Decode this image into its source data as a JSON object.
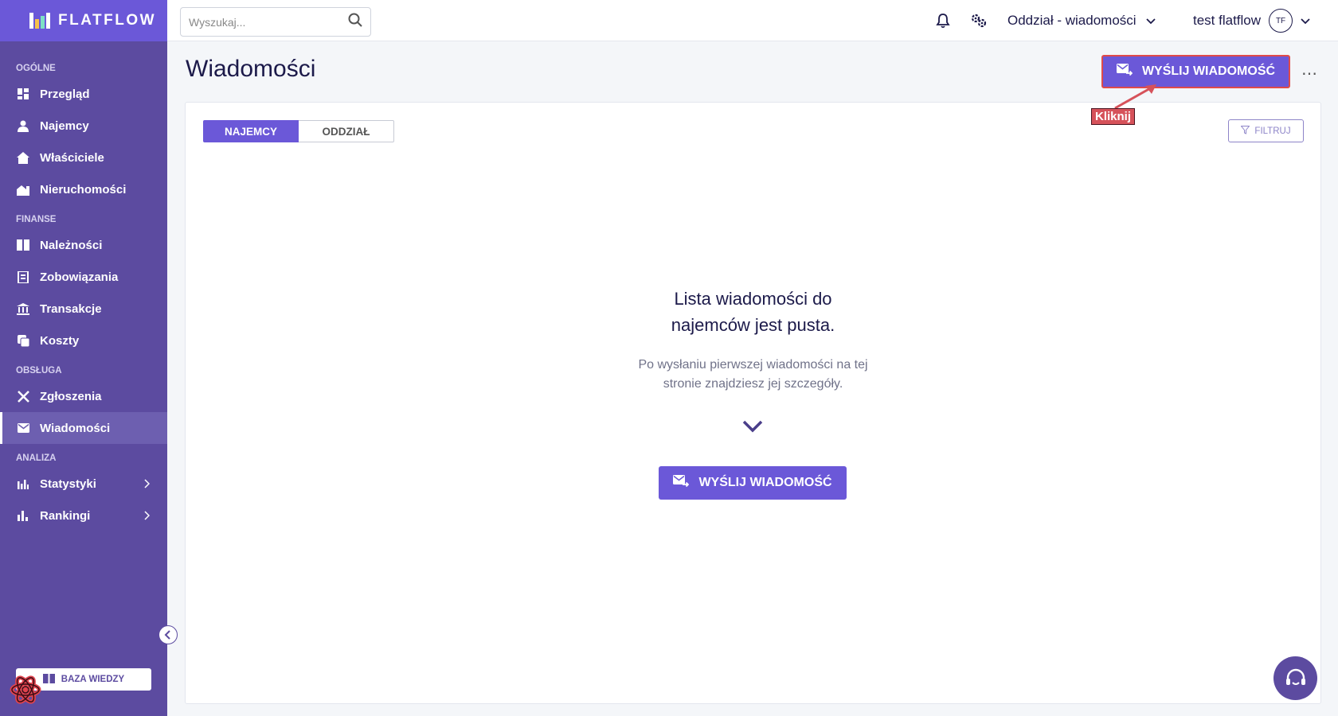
{
  "brand": {
    "name": "FLATFLOW"
  },
  "search": {
    "placeholder": "Wyszukaj..."
  },
  "topbar": {
    "branch": "Oddział - wiadomości",
    "user_name": "test flatflow",
    "avatar_initials": "TF"
  },
  "sidebar": {
    "sections": [
      {
        "label": "OGÓLNE",
        "items": [
          {
            "label": "Przegląd",
            "icon": "dashboard-icon"
          },
          {
            "label": "Najemcy",
            "icon": "tenants-icon"
          },
          {
            "label": "Właściciele",
            "icon": "owners-icon"
          },
          {
            "label": "Nieruchomości",
            "icon": "properties-icon"
          }
        ]
      },
      {
        "label": "FINANSE",
        "items": [
          {
            "label": "Należności",
            "icon": "receivables-icon"
          },
          {
            "label": "Zobowiązania",
            "icon": "liabilities-icon"
          },
          {
            "label": "Transakcje",
            "icon": "bank-icon"
          },
          {
            "label": "Koszty",
            "icon": "costs-icon"
          }
        ]
      },
      {
        "label": "OBSŁUGA",
        "items": [
          {
            "label": "Zgłoszenia",
            "icon": "tools-icon"
          },
          {
            "label": "Wiadomości",
            "icon": "mail-icon",
            "active": true
          }
        ]
      },
      {
        "label": "ANALIZA",
        "items": [
          {
            "label": "Statystyki",
            "icon": "stats-icon",
            "expandable": true
          },
          {
            "label": "Rankingi",
            "icon": "ranking-icon",
            "expandable": true
          }
        ]
      }
    ],
    "knowledge_base": "BAZA WIEDZY"
  },
  "page": {
    "title": "Wiadomości",
    "send_button": "WYŚLIJ WIADOMOŚĆ",
    "annotation": "Kliknij"
  },
  "tabs": [
    {
      "label": "NAJEMCY",
      "active": true
    },
    {
      "label": "ODDZIAŁ",
      "active": false
    }
  ],
  "filter": {
    "label": "FILTRUJ"
  },
  "empty_state": {
    "title_line1": "Lista wiadomości do",
    "title_line2": "najemców jest pusta.",
    "subtitle_line1": "Po wysłaniu pierwszej wiadomości na tej",
    "subtitle_line2": "stronie znajdziesz jej szczegóły.",
    "button": "WYŚLIJ WIADOMOŚĆ"
  },
  "colors": {
    "sidebar": "#5c4ba0",
    "primary": "#6b58d8",
    "annotation": "#d6525a"
  }
}
